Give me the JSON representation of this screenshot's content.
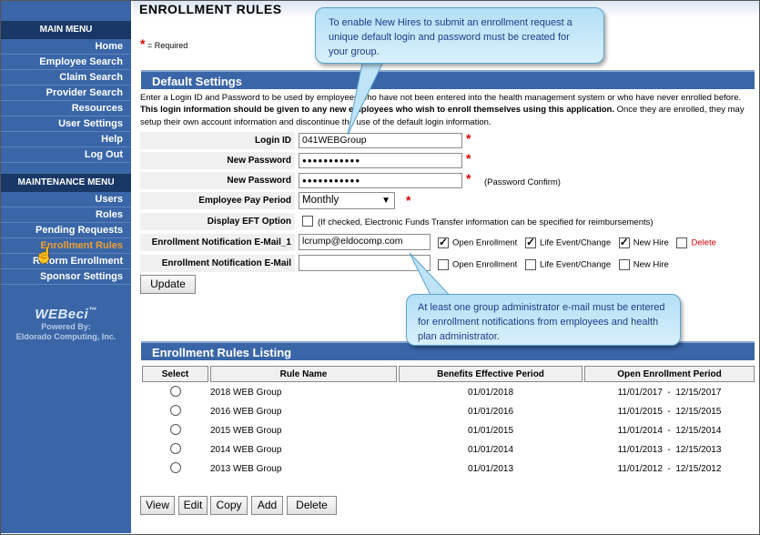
{
  "page_title": "ENROLLMENT RULES",
  "required_note": "= Required",
  "sidebar": {
    "main_menu_title": "MAIN MENU",
    "main_items": [
      {
        "label": "Home"
      },
      {
        "label": "Employee Search"
      },
      {
        "label": "Claim Search"
      },
      {
        "label": "Provider Search"
      },
      {
        "label": "Resources"
      },
      {
        "label": "User Settings"
      },
      {
        "label": "Help"
      },
      {
        "label": "Log Out"
      }
    ],
    "maint_menu_title": "MAINTENANCE MENU",
    "maint_items": [
      {
        "label": "Users"
      },
      {
        "label": "Roles"
      },
      {
        "label": "Pending Requests"
      },
      {
        "label": "Enrollment Rules"
      },
      {
        "label": "Reform Enrollment"
      },
      {
        "label": "Sponsor Settings"
      }
    ],
    "active_item": "Enrollment Rules",
    "logo": {
      "brand": "WEBeci",
      "tm": "™",
      "powered": "Powered By:",
      "company": "Eldorado Computing, Inc."
    }
  },
  "default_settings": {
    "title": "Default Settings",
    "intro_plain_1": "Enter a Login ID and Password to be used by employees who have not been entered into the health management system or who have never enrolled before. ",
    "intro_bold": "This login information should be given to any new employees who wish to enroll themselves using this application.",
    "intro_plain_2": " Once they are enrolled, they may setup their own account information and discontinue the use of the default login information.",
    "login_id_label": "Login ID",
    "login_id_value": "041WEBGroup",
    "new_password_label": "New Password",
    "new_password_value": "●●●●●●●●●●●",
    "confirm_password_label": "New Password",
    "confirm_password_value": "●●●●●●●●●●●",
    "confirm_note": "(Password Confirm)",
    "pay_period_label": "Employee Pay Period",
    "pay_period_value": "Monthly",
    "eft_label": "Display EFT Option",
    "eft_note": "(If checked, Electronic Funds Transfer information can be specified for reimbursements)",
    "email1_label": "Enrollment Notification E-Mail_1",
    "email1_value": "lcrump@eldocomp.com",
    "email2_label": "Enrollment Notification E-Mail",
    "email2_value": "",
    "cb_open": "Open Enrollment",
    "cb_life": "Life Event/Change",
    "cb_hire": "New Hire",
    "delete_label": "Delete",
    "update_label": "Update"
  },
  "listing": {
    "title": "Enrollment Rules Listing",
    "columns": [
      "Select",
      "Rule Name",
      "Benefits Effective Period",
      "Open Enrollment Period"
    ],
    "rows": [
      {
        "name": "2018 WEB Group",
        "effective": "01/01/2018",
        "open": "11/01/2017  -  12/15/2017"
      },
      {
        "name": "2016 WEB Group",
        "effective": "01/01/2016",
        "open": "11/01/2015  -  12/15/2015"
      },
      {
        "name": "2015 WEB Group",
        "effective": "01/01/2015",
        "open": "11/01/2014  -  12/15/2014"
      },
      {
        "name": "2014 WEB Group",
        "effective": "01/01/2014",
        "open": "11/01/2013  -  12/15/2013"
      },
      {
        "name": "2013 WEB Group",
        "effective": "01/01/2013",
        "open": "11/01/2012  -  12/15/2012"
      }
    ]
  },
  "buttons": {
    "view": "View",
    "edit": "Edit",
    "copy": "Copy",
    "add": "Add",
    "delete": "Delete"
  },
  "callouts": {
    "top": "To enable New Hires to submit an enrollment request a unique default login and password must be created for your group.",
    "bottom": "At least one group administrator e-mail must be entered for enrollment notifications from employees and health plan administrator."
  }
}
